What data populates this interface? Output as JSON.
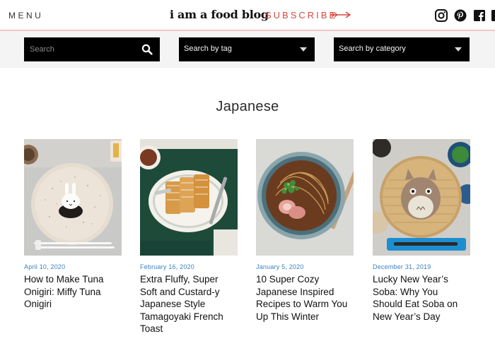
{
  "header": {
    "menu_label": "MENU",
    "logo_text": "i am a food blog",
    "subscribe_label": "SUBSCRIBE"
  },
  "filters": {
    "search_placeholder": "Search",
    "tag_label": "Search by tag",
    "category_label": "Search by category"
  },
  "page_title": "Japanese",
  "posts": [
    {
      "date": "April 10, 2020",
      "title": "How to Make Tuna Onigiri: Miffy Tuna Onigiri"
    },
    {
      "date": "February 16, 2020",
      "title": "Extra Fluffy, Super Soft and Custard-y Japanese Style Tamagoyaki French Toast"
    },
    {
      "date": "January 5, 2020",
      "title": "10 Super Cozy Japanese Inspired Recipes to Warm You Up This Winter"
    },
    {
      "date": "December 31, 2019",
      "title": "Lucky New Year’s Soba: Why You Should Eat Soba on New Year’s Day"
    }
  ],
  "colors": {
    "accent": "#d54a3f",
    "date_blue": "#3b82c4",
    "filter_bar": "#f4f4f4",
    "box_black": "#000000"
  },
  "icons": [
    "instagram-icon",
    "pinterest-icon",
    "facebook-icon",
    "search-icon",
    "arrow-icon",
    "chevron-down-icon"
  ]
}
